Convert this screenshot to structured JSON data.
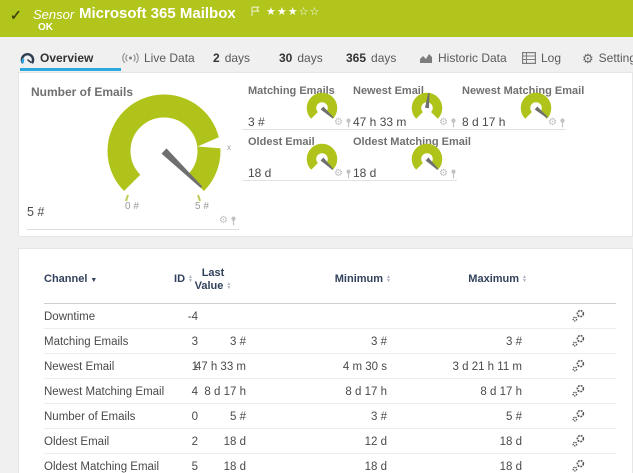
{
  "header": {
    "check": "✓",
    "kind_label": "Sensor",
    "title": "Microsoft 365 Mailbox",
    "status": "OK",
    "stars": "★★★☆☆"
  },
  "tabs": [
    {
      "label": "Overview"
    },
    {
      "label": "Live Data"
    },
    {
      "num": "2",
      "label": "days"
    },
    {
      "num": "30",
      "label": "days"
    },
    {
      "num": "365",
      "label": "days"
    },
    {
      "label": "Historic Data"
    },
    {
      "label": "Log"
    },
    {
      "label": "Settings"
    }
  ],
  "overview": {
    "main_gauge": {
      "title": "Number of Emails",
      "value": "5 #",
      "scale_min": "0 #",
      "scale_max": "5 #",
      "needle_deg": 44,
      "limit_marker": "x"
    },
    "mini_gauges": [
      {
        "title": "Matching Emails",
        "value": "3 #",
        "needle_deg": 42
      },
      {
        "title": "Newest Email",
        "value": "47 h 33 m",
        "needle_deg": -83
      },
      {
        "title": "Newest Matching Email",
        "value": "8 d 17 h",
        "needle_deg": 40
      },
      {
        "title": "Oldest Email",
        "value": "18 d",
        "needle_deg": 44
      },
      {
        "title": "Oldest Matching Email",
        "value": "18 d",
        "needle_deg": 44
      }
    ]
  },
  "table": {
    "headers": {
      "channel": "Channel",
      "id": "ID",
      "last_1": "Last",
      "last_2": "Value",
      "min": "Minimum",
      "max": "Maximum"
    },
    "rows": [
      {
        "channel": "Downtime",
        "id": "-4",
        "last": "",
        "min": "",
        "max": ""
      },
      {
        "channel": "Matching Emails",
        "id": "3",
        "last": "3 #",
        "min": "3 #",
        "max": "3 #"
      },
      {
        "channel": "Newest Email",
        "id": "1",
        "last": "47 h 33 m",
        "min": "4 m 30 s",
        "max": "3 d 21 h 11 m"
      },
      {
        "channel": "Newest Matching Email",
        "id": "4",
        "last": "8 d 17 h",
        "min": "8 d 17 h",
        "max": "8 d 17 h"
      },
      {
        "channel": "Number of Emails",
        "id": "0",
        "last": "5 #",
        "min": "3 #",
        "max": "5 #"
      },
      {
        "channel": "Oldest Email",
        "id": "2",
        "last": "18 d",
        "min": "12 d",
        "max": "18 d"
      },
      {
        "channel": "Oldest Matching Email",
        "id": "5",
        "last": "18 d",
        "min": "18 d",
        "max": "18 d"
      }
    ]
  },
  "colors": {
    "status_green": "#b2c51c",
    "gauge_green": "#afc31a",
    "accent_blue": "#2da9e1",
    "table_header_navy": "#32425c"
  }
}
